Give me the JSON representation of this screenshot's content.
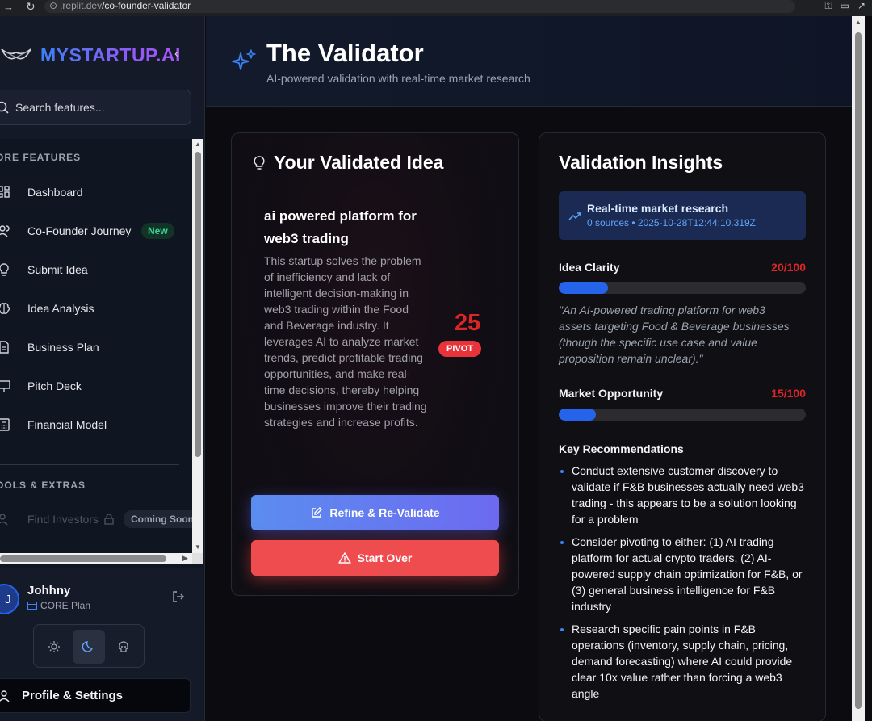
{
  "browser": {
    "url_prefix": ".replit.dev",
    "url_path": "/co-founder-validator"
  },
  "sidebar": {
    "brand": "MYSTARTUP.AI",
    "search_placeholder": "Search features...",
    "sections": {
      "core": "ORE FEATURES",
      "tools": "OOLS & EXTRAS"
    },
    "items": [
      {
        "label": "Dashboard",
        "icon": "grid-icon"
      },
      {
        "label": "Co-Founder Journey",
        "icon": "users-icon",
        "badge": "New"
      },
      {
        "label": "Submit Idea",
        "icon": "lightbulb-icon"
      },
      {
        "label": "Idea Analysis",
        "icon": "brain-icon"
      },
      {
        "label": "Business Plan",
        "icon": "document-icon"
      },
      {
        "label": "Pitch Deck",
        "icon": "presentation-icon"
      },
      {
        "label": "Financial Model",
        "icon": "calculator-icon"
      }
    ],
    "tool_items": [
      {
        "label": "Find Investors",
        "icon": "users-icon",
        "badge": "Coming Soon"
      }
    ],
    "user": {
      "initial": "J",
      "name": "Johhny",
      "plan": "CORE Plan"
    },
    "theme_active": "dark",
    "profile_label": "Profile & Settings"
  },
  "header": {
    "title": "The Validator",
    "subtitle": "AI-powered validation with real-time market research"
  },
  "idea_card": {
    "title": "Your Validated Idea",
    "idea_title": "ai powered platform for web3 trading",
    "description": "This startup solves the problem of inefficiency and lack of intelligent decision-making in web3 trading within the Food and Beverage industry. It leverages AI to analyze market trends, predict profitable trading opportunities, and make real-time decisions, thereby helping businesses improve their trading strategies and increase profits.",
    "score": "25",
    "verdict": "PIVOT",
    "refine_label": "Refine & Re-Validate",
    "start_over_label": "Start Over"
  },
  "insights": {
    "title": "Validation Insights",
    "research_title": "Real-time market research",
    "research_meta": "0 sources • 2025-10-28T12:44:10.319Z",
    "clarity_label": "Idea Clarity",
    "clarity_score": "20/100",
    "clarity_value": 20,
    "clarity_quote": "\"An AI-powered trading platform for web3 assets targeting Food & Beverage businesses (though the specific use case and value proposition remain unclear).\"",
    "market_label": "Market Opportunity",
    "market_score": "15/100",
    "market_value": 15,
    "reco_title": "Key Recommendations",
    "recommendations": [
      "Conduct extensive customer discovery to validate if F&B businesses actually need web3 trading - this appears to be a solution looking for a problem",
      "Consider pivoting to either: (1) AI trading platform for actual crypto traders, (2) AI-powered supply chain optimization for F&B, or (3) general business intelligence for F&B industry",
      "Research specific pain points in F&B operations (inventory, supply chain, pricing, demand forecasting) where AI could provide clear 10x value rather than forcing a web3 angle"
    ]
  },
  "colors": {
    "accent_blue": "#2563eb",
    "danger_red": "#dc2626",
    "new_green": "#34d399"
  }
}
